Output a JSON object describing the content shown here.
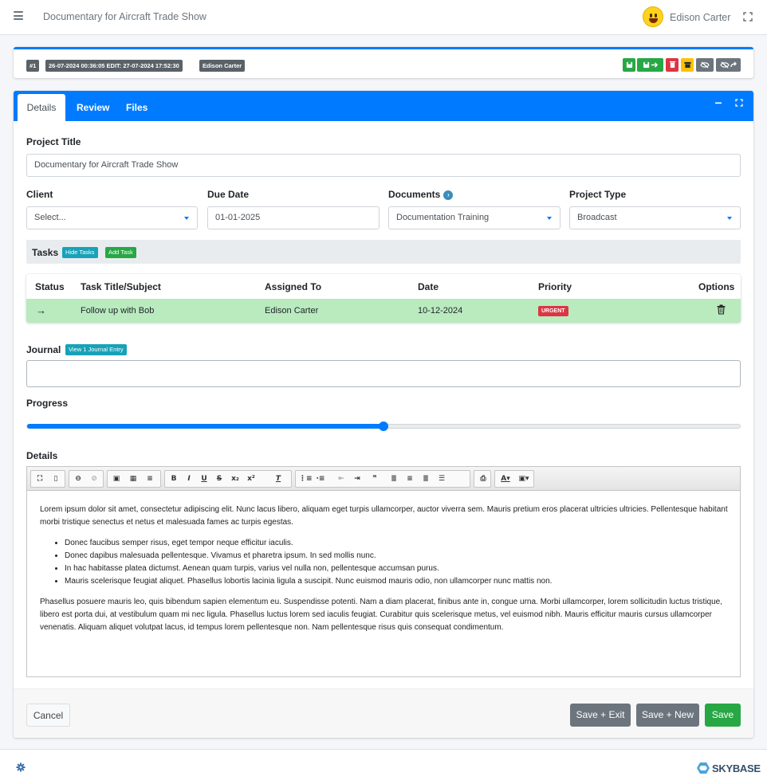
{
  "app": {
    "title": "Documentary for Aircraft Trade Show",
    "user_name": "Edison Carter"
  },
  "meta": {
    "record_id": "#1",
    "timestamps": "26-07-2024 00:36:05 EDIT: 27-07-2024 17:52:30",
    "owner": "Edison Carter"
  },
  "tabs": [
    {
      "label": "Details"
    },
    {
      "label": "Review"
    },
    {
      "label": "Files"
    }
  ],
  "form": {
    "project_title_label": "Project Title",
    "project_title_value": "Documentary for Aircraft Trade Show",
    "client_label": "Client",
    "client_value": "Select...",
    "due_date_label": "Due Date",
    "due_date_value": "01-01-2025",
    "documents_label": "Documents",
    "documents_value": "Documentation Training",
    "project_type_label": "Project Type",
    "project_type_value": "Broadcast"
  },
  "tasks": {
    "label": "Tasks",
    "hide_label": "Hide Tasks",
    "add_label": "Add Task",
    "columns": [
      "Status",
      "Task Title/Subject",
      "Assigned To",
      "Date",
      "Priority",
      "Options"
    ],
    "rows": [
      {
        "status": "→",
        "title": "Follow up with Bob",
        "assigned": "Edison Carter",
        "date": "10-12-2024",
        "priority": "URGENT"
      }
    ]
  },
  "journal": {
    "label": "Journal",
    "view_label": "View 1 Journal Entry"
  },
  "progress": {
    "label": "Progress",
    "value_fraction": 0.5
  },
  "details": {
    "label": "Details",
    "para1": "Lorem ipsum dolor sit amet, consectetur adipiscing elit. Nunc lacus libero, aliquam eget turpis ullamcorper, auctor viverra sem. Mauris pretium eros placerat ultricies ultricies. Pellentesque habitant morbi tristique senectus et netus et malesuada fames ac turpis egestas.",
    "bullets": [
      "Donec faucibus semper risus, eget tempor neque efficitur iaculis.",
      "Donec dapibus malesuada pellentesque. Vivamus et pharetra ipsum. In sed mollis nunc.",
      "In hac habitasse platea dictumst. Aenean quam turpis, varius vel nulla non, pellentesque accumsan purus.",
      "Mauris scelerisque feugiat aliquet. Phasellus lobortis lacinia ligula a suscipit. Nunc euismod mauris odio, non ullamcorper nunc mattis non."
    ],
    "para2": "Phasellus posuere mauris leo, quis bibendum sapien elementum eu. Suspendisse potenti. Nam a diam placerat, finibus ante in, congue urna. Morbi ullamcorper, lorem sollicitudin luctus tristique, libero est porta dui, at vestibulum quam mi nec ligula. Phasellus luctus lorem sed iaculis feugiat. Curabitur quis scelerisque metus, vel euismod nibh. Mauris efficitur mauris cursus ullamcorper venenatis. Aliquam aliquet volutpat lacus, id tempus lorem pellentesque non. Nam pellentesque risus quis consequat condimentum."
  },
  "footer": {
    "cancel_label": "Cancel",
    "save_exit_label": "Save + Exit",
    "save_new_label": "Save + New",
    "save_label": "Save"
  },
  "brand": {
    "name": "SKYBASE"
  },
  "colors": {
    "primary": "#007bff",
    "success": "#28a745",
    "danger": "#dc3545",
    "warning": "#ffc107",
    "secondary": "#6c757d",
    "task_row": "#b9ebbf"
  }
}
